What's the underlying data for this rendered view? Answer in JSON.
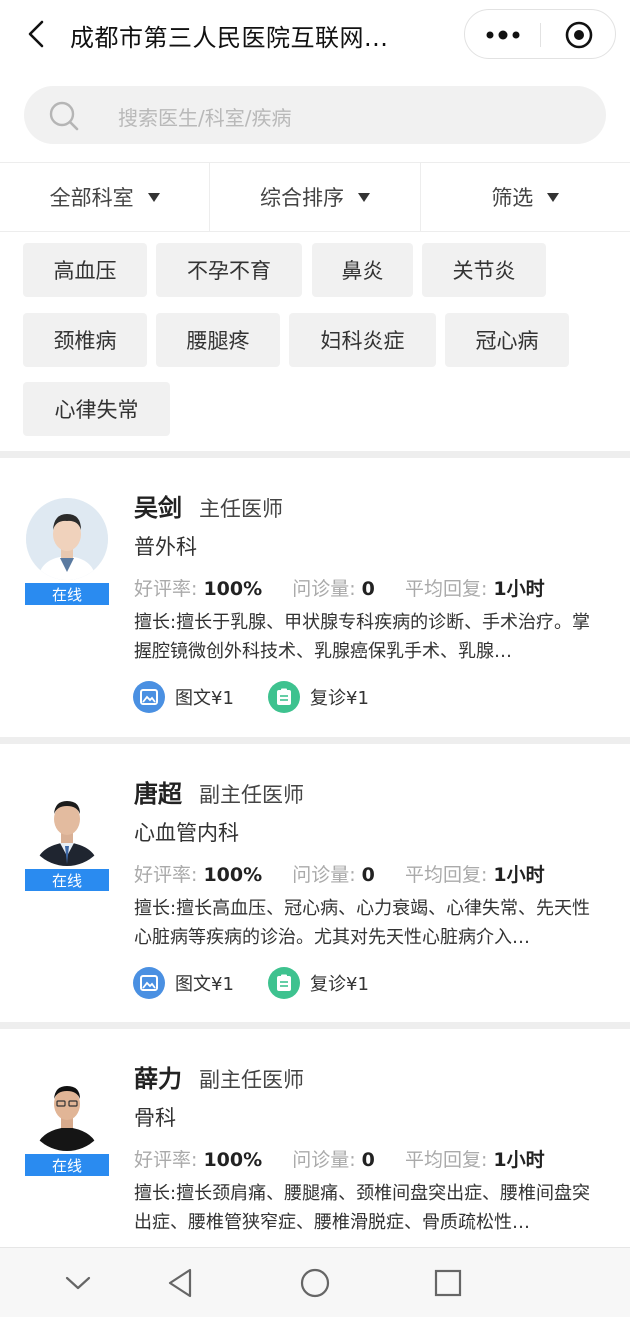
{
  "header": {
    "title": "成都市第三人民医院互联网...",
    "back_icon": "chevron-left-icon",
    "more_icon": "more-dots-icon",
    "close_icon": "target-close-icon"
  },
  "search": {
    "placeholder": "搜索医生/科室/疾病",
    "icon": "search-icon"
  },
  "filters": [
    {
      "label": "全部科室"
    },
    {
      "label": "综合排序"
    },
    {
      "label": "筛选"
    }
  ],
  "tags": [
    "高血压",
    "不孕不育",
    "鼻炎",
    "关节炎",
    "颈椎病",
    "腰腿疼",
    "妇科炎症",
    "冠心病",
    "心律失常"
  ],
  "labels": {
    "online": "在线",
    "rating": "好评率:",
    "consults": "问诊量:",
    "reply": "平均回复:",
    "service_text": "图文¥1",
    "service_revisit": "复诊¥1"
  },
  "doctors": [
    {
      "name": "吴剑",
      "title": "主任医师",
      "department": "普外科",
      "status": "在线",
      "rating": "100%",
      "consults": "0",
      "reply": "1小时",
      "skill": "擅长:擅长于乳腺、甲状腺专科疾病的诊断、手术治疗。掌握腔镜微创外科技术、乳腺癌保乳手术、乳腺…"
    },
    {
      "name": "唐超",
      "title": "副主任医师",
      "department": "心血管内科",
      "status": "在线",
      "rating": "100%",
      "consults": "0",
      "reply": "1小时",
      "skill": "擅长:擅长高血压、冠心病、心力衰竭、心律失常、先天性心脏病等疾病的诊治。尤其对先天性心脏病介入…"
    },
    {
      "name": "薛力",
      "title": "副主任医师",
      "department": "骨科",
      "status": "在线",
      "rating": "100%",
      "consults": "0",
      "reply": "1小时",
      "skill": "擅长:擅长颈肩痛、腰腿痛、颈椎间盘突出症、腰椎间盘突出症、腰椎管狭窄症、腰椎滑脱症、骨质疏松性…"
    }
  ],
  "colors": {
    "online": "#2a8bf0",
    "text_service": "#4a90e2",
    "revisit_service": "#3ec28f"
  }
}
